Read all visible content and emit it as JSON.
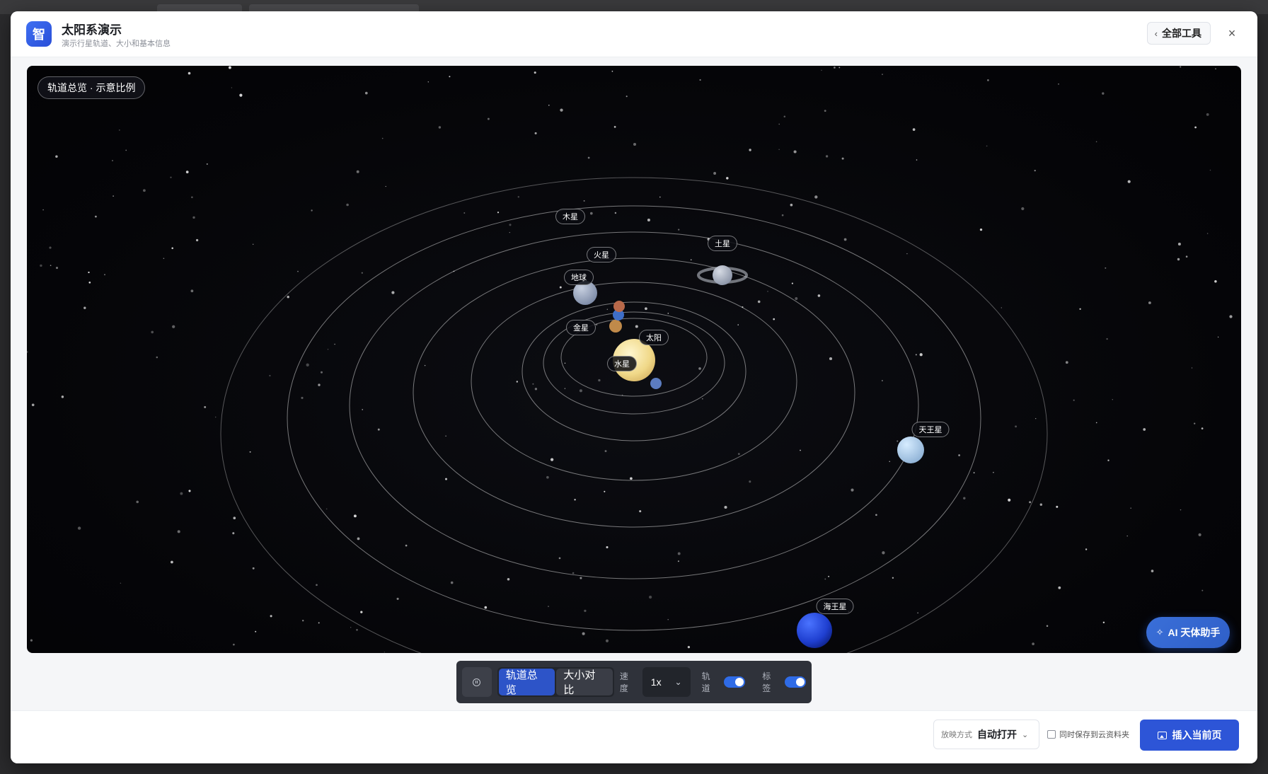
{
  "app": {
    "logo_char": "智",
    "title": "太阳系演示",
    "subtitle": "演示行星轨道、大小和基本信息"
  },
  "header": {
    "all_tools_label": "全部工具",
    "close_label": "×"
  },
  "stage": {
    "mode_tag": "轨道总览 · 示意比例",
    "labels": {
      "sun": "太阳",
      "mercury": "水星",
      "venus": "金星",
      "earth": "地球",
      "mars": "火星",
      "jupiter": "木星",
      "saturn": "土星",
      "uranus": "天王星",
      "neptune": "海王星"
    },
    "ai_button": "AI 天体助手"
  },
  "controls": {
    "tabs": [
      "轨道总览",
      "大小对比"
    ],
    "active_tab": "轨道总览",
    "speed_label": "速度",
    "speed_value": "1x",
    "orbit_label": "轨道",
    "orbit_on": true,
    "label_toggle_label": "标签",
    "labels_on": true
  },
  "footer": {
    "play_mode_label": "放映方式",
    "play_mode_value": "自动打开",
    "save_cloud_label": "同时保存到云资料夹",
    "save_cloud_checked": false,
    "insert_button": "插入当前页"
  },
  "colors": {
    "accent": "#2d55d7",
    "sun": "#f2dc93",
    "neptune": "#1f3fd0",
    "uranus": "#a9c8e8"
  },
  "icons": [
    "close-icon",
    "chevron-left-icon",
    "pause-icon",
    "chevron-down-icon",
    "sparkle-icon",
    "image-icon"
  ]
}
